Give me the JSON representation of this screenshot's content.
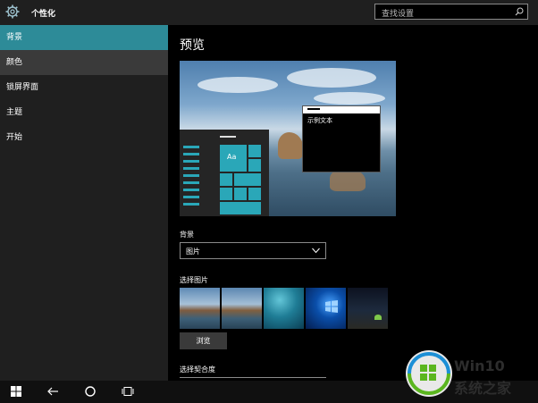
{
  "titlebar": {
    "app_title": "个性化",
    "search_placeholder": "查找设置",
    "icons": {
      "app": "gear-icon",
      "search": "search-icon"
    }
  },
  "sidebar": {
    "items": [
      {
        "label": "背景",
        "state": "selected"
      },
      {
        "label": "颜色",
        "state": "hover"
      },
      {
        "label": "锁屏界面",
        "state": "normal"
      },
      {
        "label": "主题",
        "state": "normal"
      },
      {
        "label": "开始",
        "state": "normal"
      }
    ]
  },
  "main": {
    "heading": "预览",
    "preview": {
      "tile_label": "Aa",
      "sample_window_text": "示例文本"
    },
    "background": {
      "label": "背景",
      "value": "图片"
    },
    "choose_picture": {
      "label": "选择图片",
      "thumbnails": [
        "beach-rocks-1",
        "beach-rocks-2",
        "underwater-swimmer",
        "windows-hero",
        "night-sky-tent"
      ]
    },
    "browse_label": "浏览",
    "fit": {
      "label": "选择契合度"
    }
  },
  "taskbar": {
    "icons": [
      "windows-start-icon",
      "back-arrow-icon",
      "cortana-circle-icon",
      "task-view-icon"
    ]
  },
  "watermark": {
    "line1": "Win10",
    "line2": "系统之家"
  },
  "colors": {
    "accent": "#2d8b98",
    "tile": "#2aa7b8",
    "sidebar_bg": "#1f1f1f",
    "main_bg": "#000000"
  }
}
